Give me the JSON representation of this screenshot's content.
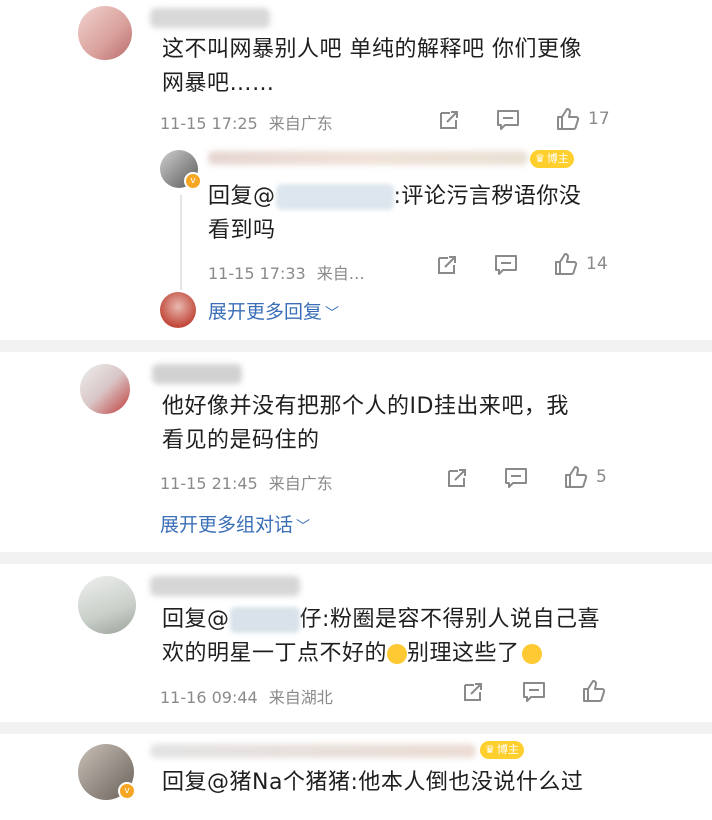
{
  "comments": [
    {
      "text": "这不叫网暴别人吧 单纯的解释吧 你们更像网暴吧……",
      "line1": "这不叫网暴别人吧 单纯的解释吧 你们更像",
      "line2": "网暴吧……",
      "timestamp": "11-15 17:25",
      "location": "来自广东",
      "likes": "17",
      "reply": {
        "badge": "博主",
        "prefix": "回复@",
        "suffix": ":评论污言秽语你没",
        "line2": "看到吗",
        "timestamp": "11-15 17:33",
        "location": "来自…",
        "likes": "14"
      },
      "expand": "展开更多回复"
    },
    {
      "line1": "他好像并没有把那个人的ID挂出来吧，我",
      "line2": "看见的是码住的",
      "timestamp": "11-15 21:45",
      "location": "来自广东",
      "likes": "5",
      "expand": "展开更多组对话"
    },
    {
      "prefix": "回复@",
      "partial": "仔",
      "line1_rest": ":粉圈是容不得别人说自己喜",
      "line2_a": "欢的明星一丁点不好的",
      "line2_b": "别理这些了",
      "timestamp": "11-16 09:44",
      "location": "来自湖北"
    },
    {
      "badge": "博主",
      "text": "回复@猪Na个猪猪:他本人倒也没说什么过"
    }
  ],
  "colors": {
    "link": "#3a6fb8",
    "meta": "#8a8a8a",
    "badge": "#ffcf2e",
    "divider": "#f2f2f2"
  },
  "icons": [
    "share-icon",
    "comment-icon",
    "like-icon",
    "chevron-down-icon",
    "verified-badge-icon"
  ]
}
